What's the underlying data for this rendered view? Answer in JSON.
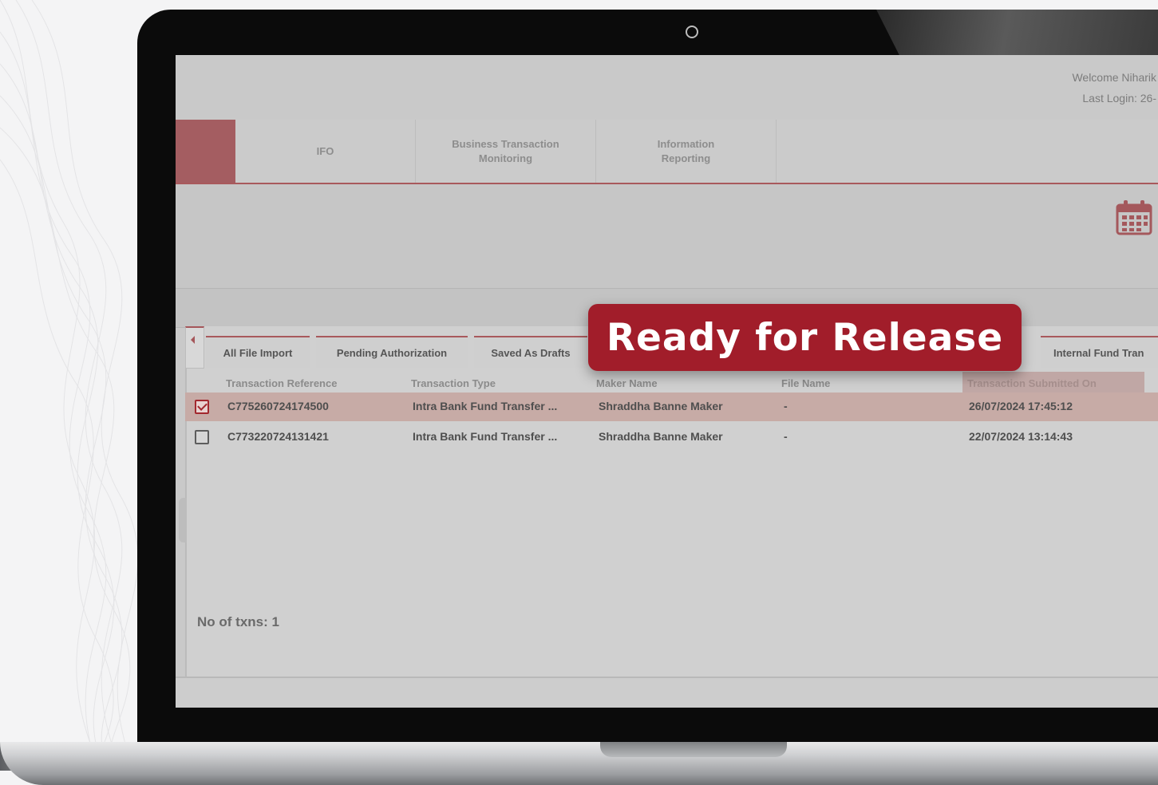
{
  "header": {
    "welcome_text": "Welcome Niharik",
    "last_login_text": "Last Login: 26-"
  },
  "nav": {
    "items": [
      {
        "label": "IFO"
      },
      {
        "label": "Business Transaction\nMonitoring"
      },
      {
        "label": "Information\nReporting"
      }
    ]
  },
  "tabs": [
    {
      "label": "All File Import"
    },
    {
      "label": "Pending Authorization"
    },
    {
      "label": "Saved As Drafts"
    },
    {
      "label": "Internal Fund Tran"
    }
  ],
  "table": {
    "columns": [
      "Transaction Reference",
      "Transaction Type",
      "Maker Name",
      "File Name",
      "Transaction Submitted On"
    ],
    "rows": [
      {
        "selected": true,
        "reference": "C775260724174500",
        "type": "Intra Bank Fund Transfer ...",
        "maker": "Shraddha Banne Maker",
        "file": "-",
        "submitted": "26/07/2024 17:45:12"
      },
      {
        "selected": false,
        "reference": "C773220724131421",
        "type": "Intra Bank Fund Transfer ...",
        "maker": "Shraddha Banne Maker",
        "file": "-",
        "submitted": "22/07/2024 13:14:43"
      }
    ]
  },
  "count_text": "No of txns: 1",
  "overlay": {
    "badge_text": "Ready for Release"
  },
  "colors": {
    "brand_red": "#a11d2a",
    "screen_dim": "#c9c9c9"
  },
  "icons": {
    "calendar": "calendar-icon",
    "collapse": "chevron-left-icon",
    "camera": "camera-icon"
  }
}
